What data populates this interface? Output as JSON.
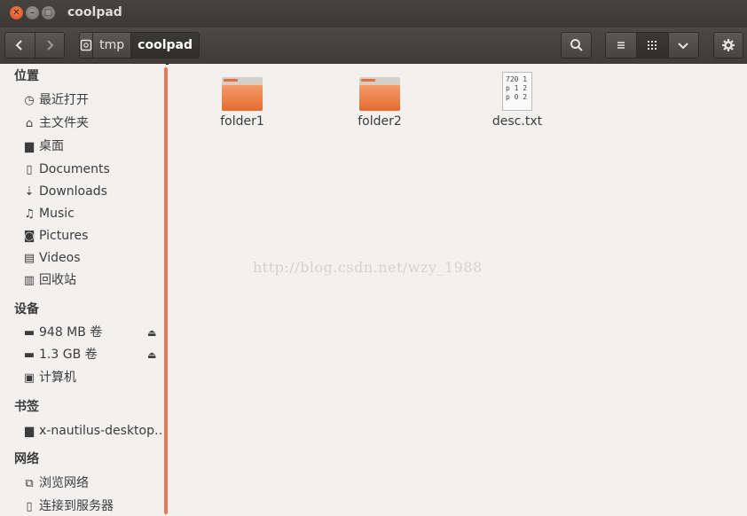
{
  "window": {
    "title": "coolpad"
  },
  "toolbar": {
    "path": [
      "tmp",
      "coolpad"
    ]
  },
  "sidebar": {
    "sections": {
      "places": "位置",
      "devices": "设备",
      "bookmarks": "书签",
      "network": "网络"
    },
    "places": [
      {
        "label": "最近打开",
        "icon": "clock-icon"
      },
      {
        "label": "主文件夹",
        "icon": "home-icon"
      },
      {
        "label": "桌面",
        "icon": "desktop-folder-icon"
      },
      {
        "label": "Documents",
        "icon": "document-icon"
      },
      {
        "label": "Downloads",
        "icon": "download-icon"
      },
      {
        "label": "Music",
        "icon": "music-icon"
      },
      {
        "label": "Pictures",
        "icon": "camera-icon"
      },
      {
        "label": "Videos",
        "icon": "film-icon"
      },
      {
        "label": "回收站",
        "icon": "trash-icon"
      }
    ],
    "devices": [
      {
        "label": "948 MB 卷",
        "icon": "drive-icon"
      },
      {
        "label": "1.3 GB 卷",
        "icon": "drive-icon"
      },
      {
        "label": "计算机",
        "icon": "computer-icon"
      }
    ],
    "bookmarks": [
      {
        "label": "x-nautilus-desktop…",
        "icon": "desktop-bookmark-icon"
      }
    ],
    "network": [
      {
        "label": "浏览网络",
        "icon": "network-icon"
      },
      {
        "label": "连接到服务器",
        "icon": "server-icon"
      }
    ]
  },
  "files": [
    {
      "name": "folder1",
      "type": "folder"
    },
    {
      "name": "folder2",
      "type": "folder"
    },
    {
      "name": "desc.txt",
      "type": "text",
      "preview": "720 1\np 1 2\np 0 2"
    }
  ],
  "watermark": "http://blog.csdn.net/wzy_1988",
  "colors": {
    "accent": "#dd4814",
    "folder": "#e46c30"
  }
}
